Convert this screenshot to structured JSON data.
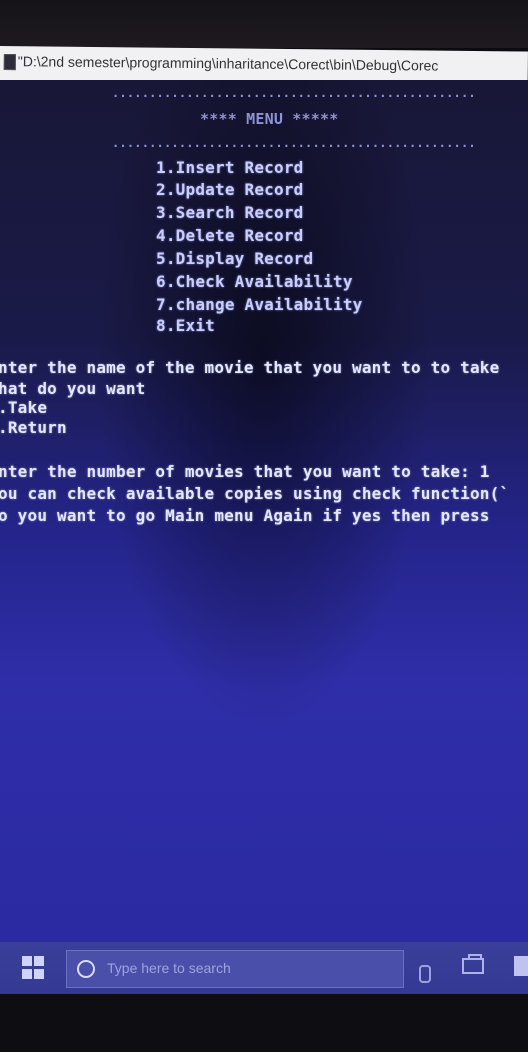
{
  "window": {
    "title": "\"D:\\2nd semester\\programming\\inharitance\\Corect\\bin\\Debug\\Corec"
  },
  "console": {
    "dots_top": ".................................................",
    "menu_header": "**** MENU *****",
    "dots_bottom": ".................................................",
    "menu_items": [
      "1.Insert Record",
      "2.Update Record",
      "3.Search Record",
      "4.Delete Record",
      "5.Display Record",
      "6.Check Availability",
      "7.change Availability",
      "8.Exit"
    ],
    "lines": [
      "nter the name of the movie that you want to to take",
      "hat do you want",
      ".Take",
      ".Return",
      "nter the number of movies that you want to take: 1",
      "ou can check available copies using check function(`",
      "o you want to go Main menu Again  if yes then press"
    ]
  },
  "taskbar": {
    "start_icon": "windows-logo-icon",
    "search_placeholder": "Type here to search",
    "search_icon": "cortana-circle-icon",
    "mic_icon": "microphone-icon",
    "taskview_icon": "task-view-icon"
  }
}
